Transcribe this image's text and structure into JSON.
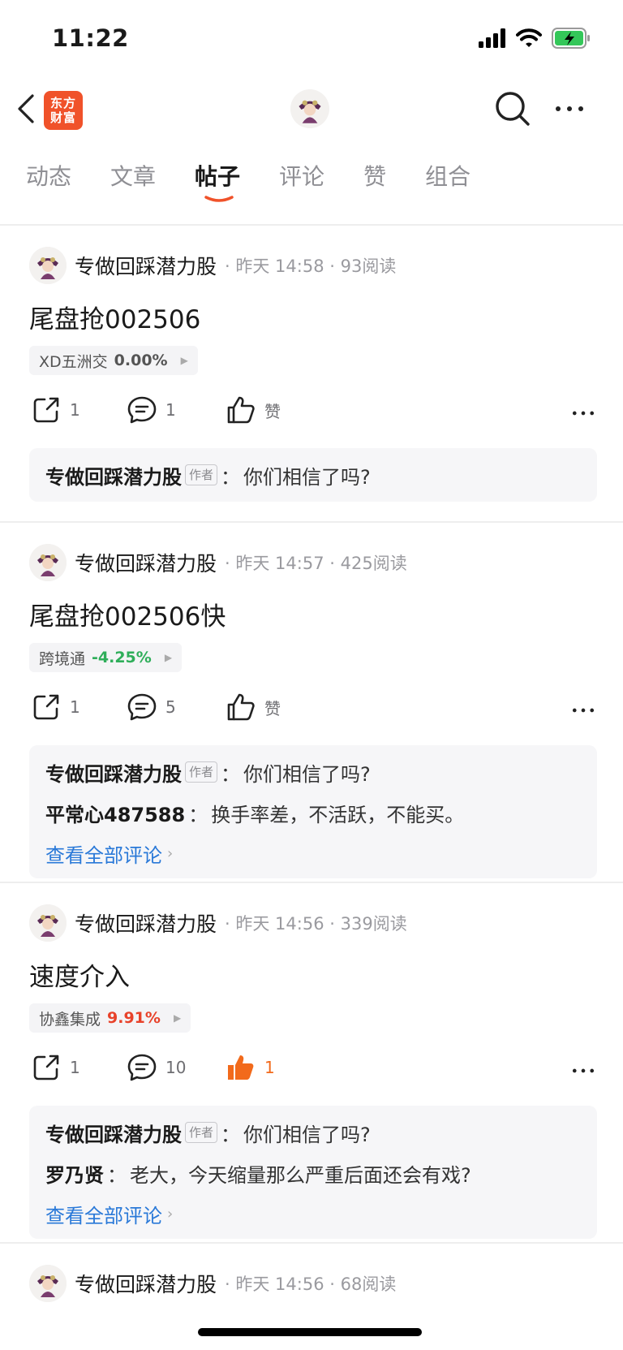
{
  "status_bar": {
    "time": "11:22"
  },
  "nav": {
    "brand_line1": "东方",
    "brand_line2": "财富"
  },
  "tabs": [
    {
      "label": "动态"
    },
    {
      "label": "文章"
    },
    {
      "label": "帖子"
    },
    {
      "label": "评论"
    },
    {
      "label": "赞"
    },
    {
      "label": "组合"
    }
  ],
  "active_tab": "帖子",
  "colors": {
    "brand": "#f0522a",
    "up": "#e8422a",
    "down": "#2fae5a",
    "link": "#2a79d8"
  },
  "posts": [
    {
      "author": "专做回踩潜力股",
      "time": "昨天 14:58",
      "reads": "93阅读",
      "title": "尾盘抢002506",
      "stock_name": "XD五洲交",
      "stock_pct": "0.00%",
      "shares": "1",
      "comments": "1",
      "like_label": "赞",
      "comment_lines": [
        {
          "name": "专做回踩潜力股",
          "badge": "作者",
          "sep": "：",
          "text": "你们相信了吗?"
        }
      ]
    },
    {
      "author": "专做回踩潜力股",
      "time": "昨天 14:57",
      "reads": "425阅读",
      "title": "尾盘抢002506快",
      "stock_name": "跨境通",
      "stock_pct": "-4.25%",
      "shares": "1",
      "comments": "5",
      "like_label": "赞",
      "comment_lines": [
        {
          "name": "专做回踩潜力股",
          "badge": "作者",
          "sep": "：",
          "text": "你们相信了吗?"
        },
        {
          "name": "平常心487588",
          "sep": "：",
          "text": "换手率差，不活跃，不能买。"
        }
      ],
      "view_all": "查看全部评论"
    },
    {
      "author": "专做回踩潜力股",
      "time": "昨天 14:56",
      "reads": "339阅读",
      "title": "速度介入",
      "stock_name": "协鑫集成",
      "stock_pct": "9.91%",
      "shares": "1",
      "comments": "10",
      "likes": "1",
      "comment_lines": [
        {
          "name": "专做回踩潜力股",
          "badge": "作者",
          "sep": "：",
          "text": "你们相信了吗?"
        },
        {
          "name": "罗乃贤",
          "sep": "：",
          "text": "老大，今天缩量那么严重后面还会有戏?"
        }
      ],
      "view_all": "查看全部评论"
    },
    {
      "author": "专做回踩潜力股",
      "time": "昨天 14:56",
      "reads": "68阅读"
    }
  ]
}
